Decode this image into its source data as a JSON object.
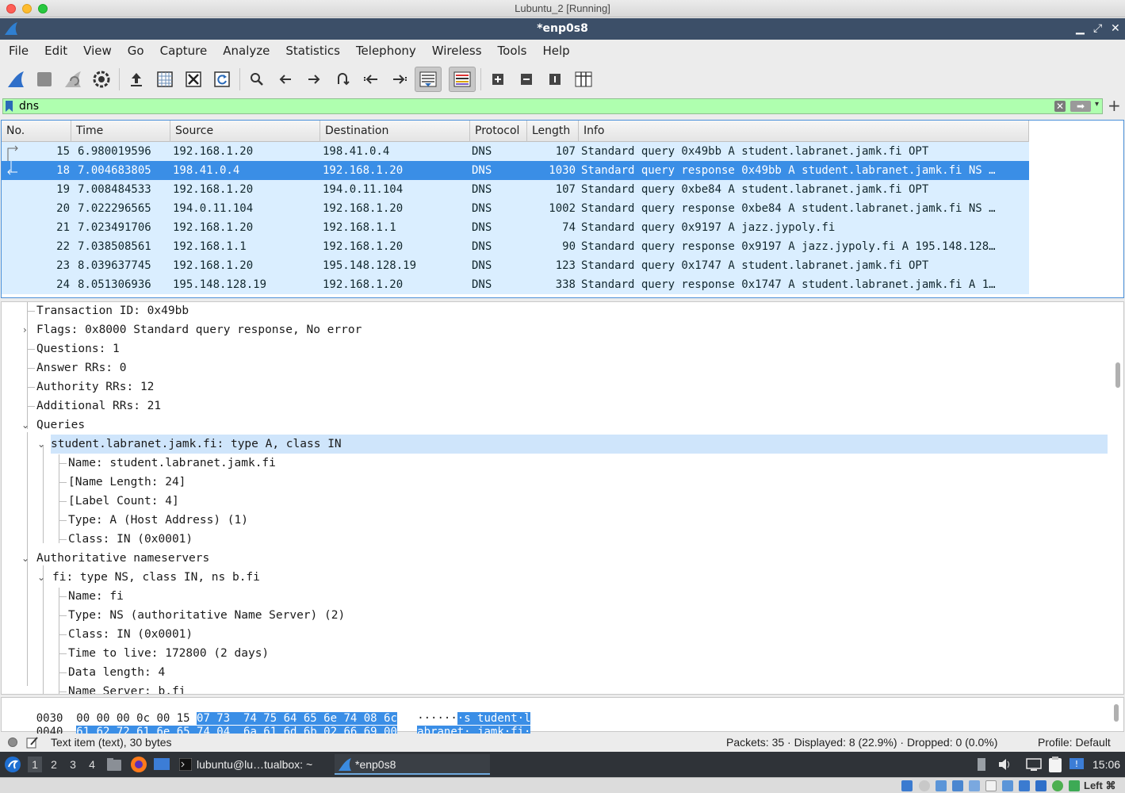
{
  "host_window": {
    "title": "Lubuntu_2 [Running]"
  },
  "app": {
    "title": "*enp0s8"
  },
  "menu": [
    "File",
    "Edit",
    "View",
    "Go",
    "Capture",
    "Analyze",
    "Statistics",
    "Telephony",
    "Wireless",
    "Tools",
    "Help"
  ],
  "filter": {
    "value": "dns"
  },
  "columns": [
    "No.",
    "Time",
    "Source",
    "Destination",
    "Protocol",
    "Length",
    "Info"
  ],
  "packets": [
    {
      "no": "15",
      "time": "6.980019596",
      "source": "192.168.1.20",
      "destination": "198.41.0.4",
      "protocol": "DNS",
      "length": "107",
      "info": "Standard query 0x49bb A student.labranet.jamk.fi OPT"
    },
    {
      "no": "18",
      "time": "7.004683805",
      "source": "198.41.0.4",
      "destination": "192.168.1.20",
      "protocol": "DNS",
      "length": "1030",
      "info": "Standard query response 0x49bb A student.labranet.jamk.fi NS …"
    },
    {
      "no": "19",
      "time": "7.008484533",
      "source": "192.168.1.20",
      "destination": "194.0.11.104",
      "protocol": "DNS",
      "length": "107",
      "info": "Standard query 0xbe84 A student.labranet.jamk.fi OPT"
    },
    {
      "no": "20",
      "time": "7.022296565",
      "source": "194.0.11.104",
      "destination": "192.168.1.20",
      "protocol": "DNS",
      "length": "1002",
      "info": "Standard query response 0xbe84 A student.labranet.jamk.fi NS …"
    },
    {
      "no": "21",
      "time": "7.023491706",
      "source": "192.168.1.20",
      "destination": "192.168.1.1",
      "protocol": "DNS",
      "length": "74",
      "info": "Standard query 0x9197 A jazz.jypoly.fi"
    },
    {
      "no": "22",
      "time": "7.038508561",
      "source": "192.168.1.1",
      "destination": "192.168.1.20",
      "protocol": "DNS",
      "length": "90",
      "info": "Standard query response 0x9197 A jazz.jypoly.fi A 195.148.128…"
    },
    {
      "no": "23",
      "time": "8.039637745",
      "source": "192.168.1.20",
      "destination": "195.148.128.19",
      "protocol": "DNS",
      "length": "123",
      "info": "Standard query 0x1747 A student.labranet.jamk.fi OPT"
    },
    {
      "no": "24",
      "time": "8.051306936",
      "source": "195.148.128.19",
      "destination": "192.168.1.20",
      "protocol": "DNS",
      "length": "338",
      "info": "Standard query response 0x1747 A student.labranet.jamk.fi A 1…"
    }
  ],
  "details": [
    "Transaction ID: 0x49bb",
    "Flags: 0x8000 Standard query response, No error",
    "Questions: 1",
    "Answer RRs: 0",
    "Authority RRs: 12",
    "Additional RRs: 21",
    "Queries",
    "student.labranet.jamk.fi: type A, class IN",
    "Name: student.labranet.jamk.fi",
    "[Name Length: 24]",
    "[Label Count: 4]",
    "Type: A (Host Address) (1)",
    "Class: IN (0x0001)",
    "Authoritative nameservers",
    "fi: type NS, class IN, ns b.fi",
    "Name: fi",
    "Type: NS (authoritative Name Server) (2)",
    "Class: IN (0x0001)",
    "Time to live: 172800 (2 days)",
    "Data length: 4",
    "Name Server: b.fi"
  ],
  "bytes": [
    {
      "offset": "0030",
      "hex_plain": "00 00 00 0c 00 15 ",
      "hex_sel": "07 73  74 75 64 65 6e 74 08 6c",
      "ascii_plain": "······",
      "ascii_sel": "·s tudent·l"
    },
    {
      "offset": "0040",
      "hex_plain": "",
      "hex_sel": "61 62 72 61 6e 65 74 04  6a 61 6d 6b 02 66 69 00",
      "ascii_plain": "",
      "ascii_sel": "abranet· jamk·fi·"
    }
  ],
  "status": {
    "text": "Text item (text), 30 bytes",
    "packets": "Packets: 35 · Displayed: 8 (22.9%) · Dropped: 0 (0.0%)",
    "profile": "Profile: Default"
  },
  "taskbar": {
    "workspaces": [
      "1",
      "2",
      "3",
      "4"
    ],
    "terminal_task": "lubuntu@lu…tualbox: ~",
    "wireshark_task": "*enp0s8",
    "clock": "15:06"
  },
  "vbox": {
    "host_key": "Left ⌘"
  },
  "colors": {
    "row_bg": "#daeeff",
    "selected_row": "#3a8ee6",
    "filter_ok": "#afffaf",
    "titlebar": "#3c4f68"
  }
}
